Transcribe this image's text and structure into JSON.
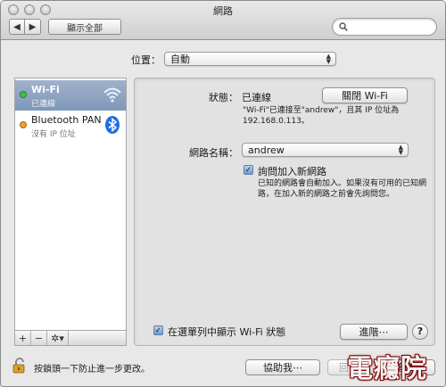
{
  "window": {
    "title": "網路"
  },
  "toolbar": {
    "back_glyph": "◀",
    "forward_glyph": "▶",
    "show_all_label": "顯示全部",
    "search_placeholder": ""
  },
  "location": {
    "label": "位置：",
    "value": "自動"
  },
  "services": [
    {
      "name": "Wi-Fi",
      "status": "已連線",
      "status_color": "#3cc43c",
      "icon": "wifi-icon",
      "selected": true
    },
    {
      "name": "Bluetooth PAN",
      "status": "沒有 IP 位址",
      "status_color": "#f0a030",
      "icon": "bluetooth-icon",
      "selected": false
    }
  ],
  "sidebar_tools": {
    "add": "+",
    "remove": "−",
    "gear": "✲▾"
  },
  "detail": {
    "status_label": "狀態：",
    "status_value": "已連線",
    "turn_off_button": "關閉 Wi-Fi",
    "status_note_line1": "\"Wi-Fi\"已連接至\"andrew\"，且其 IP 位址為",
    "status_note_line2": "192.168.0.113。",
    "network_name_label": "網路名稱：",
    "network_name_value": "andrew",
    "ask_join_label": "詢問加入新網路",
    "ask_join_checked": true,
    "ask_join_note_line1": "已知的網路會自動加入。如果沒有可用的已知網",
    "ask_join_note_line2": "路，在加入新的網路之前會先詢問您。",
    "show_menu_label": "在選單列中顯示 Wi-Fi 狀態",
    "show_menu_checked": true,
    "advanced_button": "進階⋯",
    "help_glyph": "?"
  },
  "footer": {
    "lock_text": "按鎖頭一下防止進一步更改。",
    "assist_button": "協助我⋯",
    "revert_button": "回復",
    "apply_button": "套用"
  },
  "watermark": "電癮院",
  "colors": {
    "selection": "#8aa0c2",
    "bluetooth": "#1f6fe0"
  }
}
